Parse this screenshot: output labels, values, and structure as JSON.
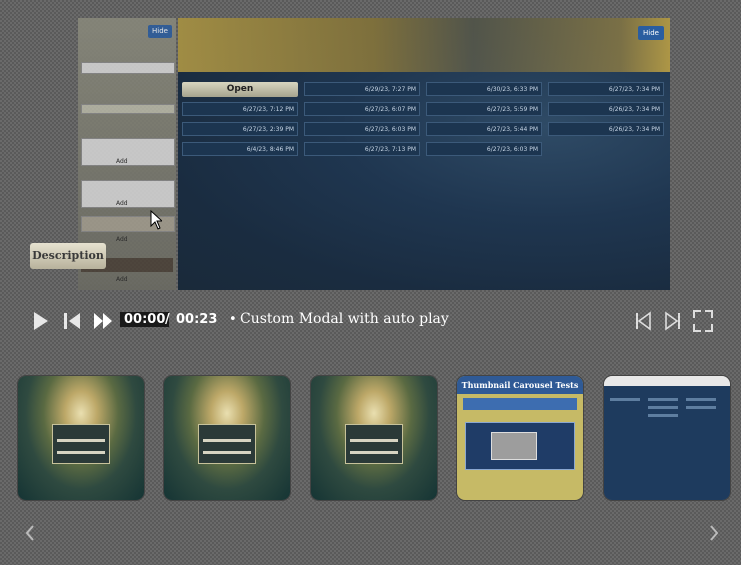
{
  "preview": {
    "left_panel": {
      "hide_label": "Hide",
      "add_label": "Add"
    },
    "right_panel": {
      "hide_label": "Hide",
      "open_label": "Open",
      "tiles": [
        {
          "time": "6/29/23, 7:27 PM"
        },
        {
          "time": "6/30/23, 6:33 PM"
        },
        {
          "time": "6/27/23, 7:34 PM"
        },
        {
          "time": "6/27/23, 7:12 PM"
        },
        {
          "time": "6/27/23, 6:07 PM"
        },
        {
          "time": "6/27/23, 5:59 PM"
        },
        {
          "time": "6/26/23, 7:34 PM"
        },
        {
          "time": "6/27/23, 2:39 PM"
        },
        {
          "time": "6/27/23, 6:03 PM"
        },
        {
          "time": "6/27/23, 5:44 PM"
        },
        {
          "time": "6/26/23, 7:34 PM"
        },
        {
          "time": "6/4/23, 8:46 PM"
        },
        {
          "time": "6/27/23, 7:13 PM"
        },
        {
          "time": "6/27/23, 6:03 PM"
        }
      ]
    }
  },
  "tooltip": {
    "description": "Description"
  },
  "player": {
    "current_time": "00:00",
    "separator": "/",
    "duration": "00:23",
    "bullet": "•",
    "title": "Custom Modal with auto play"
  },
  "thumbnails": {
    "carousel_heading": "Thumbnail Carousel Tests"
  },
  "colors": {
    "accent_blue": "#2a5da0",
    "gold": "#c6a744"
  }
}
